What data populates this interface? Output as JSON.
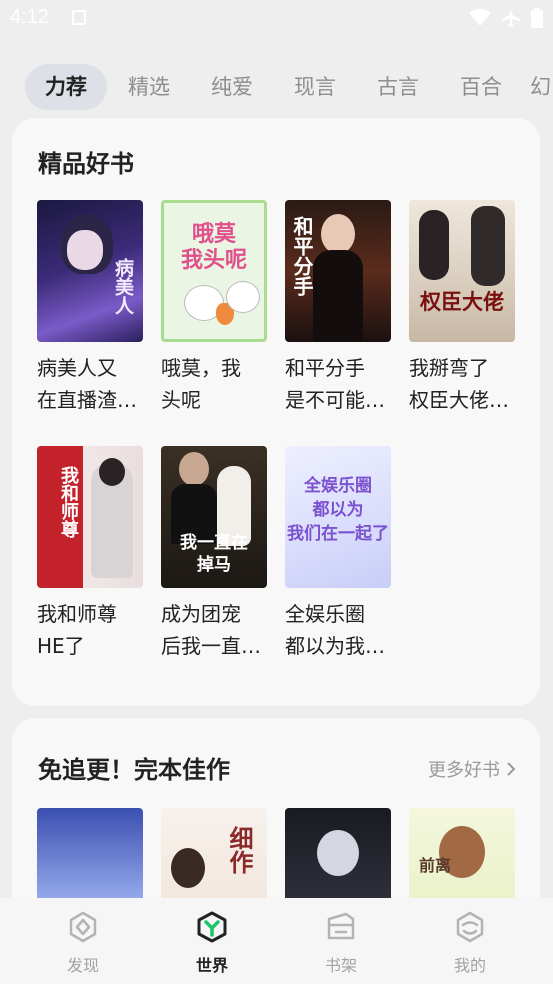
{
  "status": {
    "time": "4:12"
  },
  "tabs": [
    {
      "label": "力荐",
      "active": true
    },
    {
      "label": "精选"
    },
    {
      "label": "纯爱"
    },
    {
      "label": "现言"
    },
    {
      "label": "古言"
    },
    {
      "label": "百合"
    },
    {
      "label": "幻"
    }
  ],
  "section1": {
    "title": "精品好书",
    "books": [
      {
        "title": "病美人又\n在直播渣…",
        "cover_text": "病美人"
      },
      {
        "title": "哦莫，我\n头呢",
        "cover_text": "哦莫\n我头呢"
      },
      {
        "title": "和平分手\n是不可能…",
        "cover_text": "和平分手"
      },
      {
        "title": "我掰弯了\n权臣大佬…",
        "cover_text": "权臣大佬"
      },
      {
        "title": "我和师尊\nHE了",
        "cover_text": "我和师尊"
      },
      {
        "title": "成为团宠\n后我一直…",
        "cover_text": "我一直在\n掉马"
      },
      {
        "title": "全娱乐圈\n都以为我…",
        "cover_text": "全娱乐圈\n都以为\n我们在一起了"
      }
    ]
  },
  "section2": {
    "title": "免追更！完本佳作",
    "more_label": "更多好书",
    "books": [
      {
        "title": ""
      },
      {
        "title": "",
        "cover_text": "细作"
      },
      {
        "title": ""
      },
      {
        "title": "",
        "cover_text": "前离"
      }
    ]
  },
  "nav": [
    {
      "label": "发现",
      "icon": "discover-icon"
    },
    {
      "label": "世界",
      "icon": "world-icon",
      "active": true
    },
    {
      "label": "书架",
      "icon": "bookshelf-icon"
    },
    {
      "label": "我的",
      "icon": "profile-icon"
    }
  ],
  "colors": {
    "background": "#eeeeee",
    "card": "#f8f8f8",
    "active_tab": "#dde0e6",
    "accent_green": "#1fc46a"
  }
}
